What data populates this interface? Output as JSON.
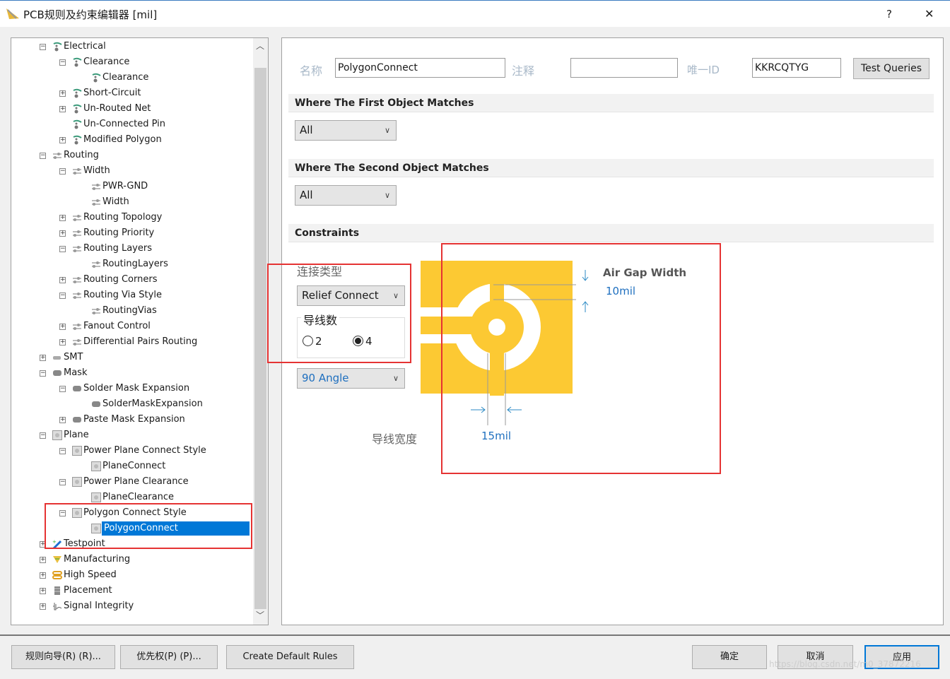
{
  "window": {
    "title": "PCB规则及约束编辑器 [mil]",
    "help": "?",
    "close": "✕"
  },
  "tree": [
    {
      "level": 0,
      "exp": "-",
      "icon": "electrical",
      "label": "Electrical"
    },
    {
      "level": 1,
      "exp": "-",
      "icon": "electrical",
      "label": "Clearance"
    },
    {
      "level": 2,
      "exp": "",
      "icon": "electrical",
      "label": "Clearance"
    },
    {
      "level": 1,
      "exp": "+",
      "icon": "electrical",
      "label": "Short-Circuit"
    },
    {
      "level": 1,
      "exp": "+",
      "icon": "electrical",
      "label": "Un-Routed Net"
    },
    {
      "level": 1,
      "exp": "",
      "icon": "electrical",
      "label": "Un-Connected Pin"
    },
    {
      "level": 1,
      "exp": "+",
      "icon": "electrical",
      "label": "Modified Polygon"
    },
    {
      "level": 0,
      "exp": "-",
      "icon": "routing",
      "label": "Routing"
    },
    {
      "level": 1,
      "exp": "-",
      "icon": "routing",
      "label": "Width"
    },
    {
      "level": 2,
      "exp": "",
      "icon": "routing",
      "label": "PWR-GND"
    },
    {
      "level": 2,
      "exp": "",
      "icon": "routing",
      "label": "Width"
    },
    {
      "level": 1,
      "exp": "+",
      "icon": "routing",
      "label": "Routing Topology"
    },
    {
      "level": 1,
      "exp": "+",
      "icon": "routing",
      "label": "Routing Priority"
    },
    {
      "level": 1,
      "exp": "-",
      "icon": "routing",
      "label": "Routing Layers"
    },
    {
      "level": 2,
      "exp": "",
      "icon": "routing",
      "label": "RoutingLayers"
    },
    {
      "level": 1,
      "exp": "+",
      "icon": "routing",
      "label": "Routing Corners"
    },
    {
      "level": 1,
      "exp": "-",
      "icon": "routing",
      "label": "Routing Via Style"
    },
    {
      "level": 2,
      "exp": "",
      "icon": "routing",
      "label": "RoutingVias"
    },
    {
      "level": 1,
      "exp": "+",
      "icon": "routing",
      "label": "Fanout Control"
    },
    {
      "level": 1,
      "exp": "+",
      "icon": "routing",
      "label": "Differential Pairs Routing"
    },
    {
      "level": 0,
      "exp": "+",
      "icon": "smt",
      "label": "SMT"
    },
    {
      "level": 0,
      "exp": "-",
      "icon": "mask",
      "label": "Mask"
    },
    {
      "level": 1,
      "exp": "-",
      "icon": "mask",
      "label": "Solder Mask Expansion"
    },
    {
      "level": 2,
      "exp": "",
      "icon": "mask",
      "label": "SolderMaskExpansion"
    },
    {
      "level": 1,
      "exp": "+",
      "icon": "mask",
      "label": "Paste Mask Expansion"
    },
    {
      "level": 0,
      "exp": "-",
      "icon": "plane",
      "label": "Plane"
    },
    {
      "level": 1,
      "exp": "-",
      "icon": "plane",
      "label": "Power Plane Connect Style"
    },
    {
      "level": 2,
      "exp": "",
      "icon": "plane",
      "label": "PlaneConnect"
    },
    {
      "level": 1,
      "exp": "-",
      "icon": "plane",
      "label": "Power Plane Clearance"
    },
    {
      "level": 2,
      "exp": "",
      "icon": "plane",
      "label": "PlaneClearance"
    },
    {
      "level": 1,
      "exp": "-",
      "icon": "plane",
      "label": "Polygon Connect Style"
    },
    {
      "level": 2,
      "exp": "",
      "icon": "plane",
      "label": "PolygonConnect",
      "selected": true
    },
    {
      "level": 0,
      "exp": "+",
      "icon": "testpoint",
      "label": "Testpoint"
    },
    {
      "level": 0,
      "exp": "+",
      "icon": "manufacturing",
      "label": "Manufacturing"
    },
    {
      "level": 0,
      "exp": "+",
      "icon": "highspeed",
      "label": "High Speed"
    },
    {
      "level": 0,
      "exp": "+",
      "icon": "placement",
      "label": "Placement"
    },
    {
      "level": 0,
      "exp": "+",
      "icon": "signal",
      "label": "Signal Integrity"
    }
  ],
  "header": {
    "name_label": "名称",
    "name_value": "PolygonConnect",
    "comment_label": "注释",
    "comment_value": "",
    "uid_label": "唯一ID",
    "uid_value": "KKRCQTYG",
    "test_queries": "Test Queries"
  },
  "first": {
    "title": "Where The First Object Matches",
    "value": "All"
  },
  "second": {
    "title": "Where The Second Object Matches",
    "value": "All"
  },
  "constraints": {
    "title": "Constraints",
    "connect_type_label": "连接类型",
    "connect_type": "Relief Connect",
    "conductors_label": "导线数",
    "radio_2": "2",
    "radio_4": "4",
    "selected_conductors": 4,
    "angle": "90 Angle",
    "air_gap_label": "Air Gap Width",
    "air_gap_value": "10mil",
    "width_label": "导线宽度",
    "width_value": "15mil"
  },
  "colors": {
    "copper": "#fcc933",
    "accent": "#0078d7",
    "highlight": "#e53333",
    "dim_blue": "#1e6fbf"
  },
  "footer": {
    "wizard": "规则向导(R) (R)...",
    "priority": "优先权(P) (P)...",
    "create_default": "Create Default Rules",
    "ok": "确定",
    "cancel": "取消",
    "apply": "应用",
    "watermark": "https://blog.csdn.net/m0_37872216"
  }
}
